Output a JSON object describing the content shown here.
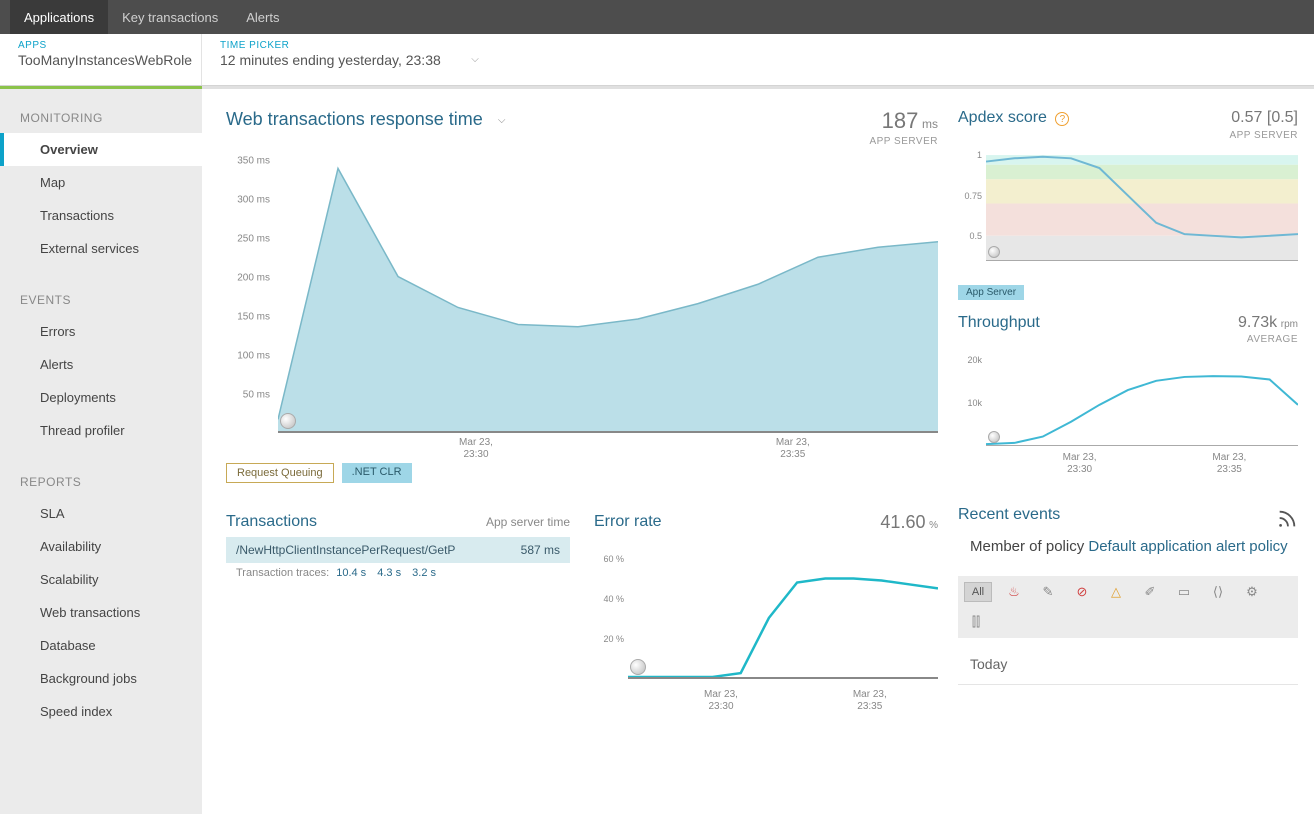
{
  "topnav": {
    "items": [
      "Applications",
      "Key transactions",
      "Alerts"
    ],
    "active": 0
  },
  "context": {
    "app_label": "APPS",
    "app_value": "TooManyInstancesWebRole",
    "time_label": "TIME PICKER",
    "time_value": "12 minutes ending yesterday, 23:38"
  },
  "sidebar": {
    "groups": [
      {
        "head": "MONITORING",
        "items": [
          "Overview",
          "Map",
          "Transactions",
          "External services"
        ],
        "active": 0
      },
      {
        "head": "EVENTS",
        "items": [
          "Errors",
          "Alerts",
          "Deployments",
          "Thread profiler"
        ]
      },
      {
        "head": "REPORTS",
        "items": [
          "SLA",
          "Availability",
          "Scalability",
          "Web transactions",
          "Database",
          "Background jobs",
          "Speed index"
        ]
      }
    ]
  },
  "response_panel": {
    "title": "Web transactions response time",
    "value": "187",
    "unit": "ms",
    "sub": "APP SERVER",
    "legend": [
      "Request Queuing",
      ".NET CLR"
    ]
  },
  "apdex_panel": {
    "title": "Apdex score",
    "value": "0.57 [0.5]",
    "sub": "APP SERVER",
    "legend": "App Server"
  },
  "throughput_panel": {
    "title": "Throughput",
    "value": "9.73k",
    "unit": "rpm",
    "sub": "AVERAGE"
  },
  "tx_panel": {
    "title": "Transactions",
    "sub": "App server time",
    "row_name": "/NewHttpClientInstancePerRequest/GetP",
    "row_time": "587 ms",
    "trace_label": "Transaction traces:",
    "traces": [
      "10.4 s",
      "4.3 s",
      "3.2 s"
    ]
  },
  "error_panel": {
    "title": "Error rate",
    "value": "41.60",
    "unit": "%"
  },
  "events_panel": {
    "title": "Recent events",
    "policy_prefix": "Member of policy ",
    "policy_link": "Default application alert policy",
    "filter_all": "All",
    "today": "Today"
  },
  "chart_data": [
    {
      "type": "area",
      "title": "Web transactions response time",
      "yticks": [
        50,
        100,
        150,
        200,
        250,
        300,
        350
      ],
      "ylabel_suffix": " ms",
      "ylim": [
        0,
        360
      ],
      "xticks": [
        "Mar 23,\n23:30",
        "Mar 23,\n23:35"
      ],
      "x": [
        0,
        1,
        2,
        3,
        4,
        5,
        6,
        7,
        8,
        9,
        10,
        11
      ],
      "values": [
        15,
        340,
        200,
        160,
        138,
        135,
        145,
        165,
        190,
        225,
        238,
        245
      ]
    },
    {
      "type": "line",
      "title": "Apdex score",
      "yticks": [
        0.5,
        0.75,
        1
      ],
      "ylim": [
        0.35,
        1.05
      ],
      "xticks": [
        "Mar 23,\n23:30",
        "Mar 23,\n23:35"
      ],
      "bands": [
        {
          "from": 0.94,
          "to": 1.0,
          "color": "#d8f5ef"
        },
        {
          "from": 0.85,
          "to": 0.94,
          "color": "#d9f0d2"
        },
        {
          "from": 0.7,
          "to": 0.85,
          "color": "#f3efcf"
        },
        {
          "from": 0.5,
          "to": 0.7,
          "color": "#f4e0dc"
        },
        {
          "from": 0.35,
          "to": 0.5,
          "color": "#e7e7e7"
        }
      ],
      "x": [
        0,
        1,
        2,
        3,
        4,
        5,
        6,
        7,
        8,
        9,
        10,
        11
      ],
      "values": [
        0.96,
        0.98,
        0.99,
        0.98,
        0.92,
        0.75,
        0.58,
        0.51,
        0.5,
        0.49,
        0.5,
        0.51
      ]
    },
    {
      "type": "line",
      "title": "Throughput",
      "yticks": [
        10000,
        20000
      ],
      "ytick_labels": [
        "10k",
        "20k"
      ],
      "ylim": [
        0,
        22000
      ],
      "xticks": [
        "Mar 23,\n23:30",
        "Mar 23,\n23:35"
      ],
      "x": [
        0,
        1,
        2,
        3,
        4,
        5,
        6,
        7,
        8,
        9,
        10,
        11
      ],
      "values": [
        200,
        500,
        2000,
        5500,
        9500,
        13000,
        15200,
        16100,
        16300,
        16200,
        15500,
        9500
      ]
    },
    {
      "type": "line",
      "title": "Error rate",
      "yticks": [
        20,
        40,
        60
      ],
      "ylabel_suffix": " %",
      "ylim": [
        0,
        65
      ],
      "xticks": [
        "Mar 23,\n23:30",
        "Mar 23,\n23:35"
      ],
      "x": [
        0,
        1,
        2,
        3,
        4,
        5,
        6,
        7,
        8,
        9,
        10,
        11
      ],
      "values": [
        0,
        0,
        0,
        0,
        2,
        30,
        48,
        50,
        50,
        49,
        47,
        45
      ]
    }
  ]
}
